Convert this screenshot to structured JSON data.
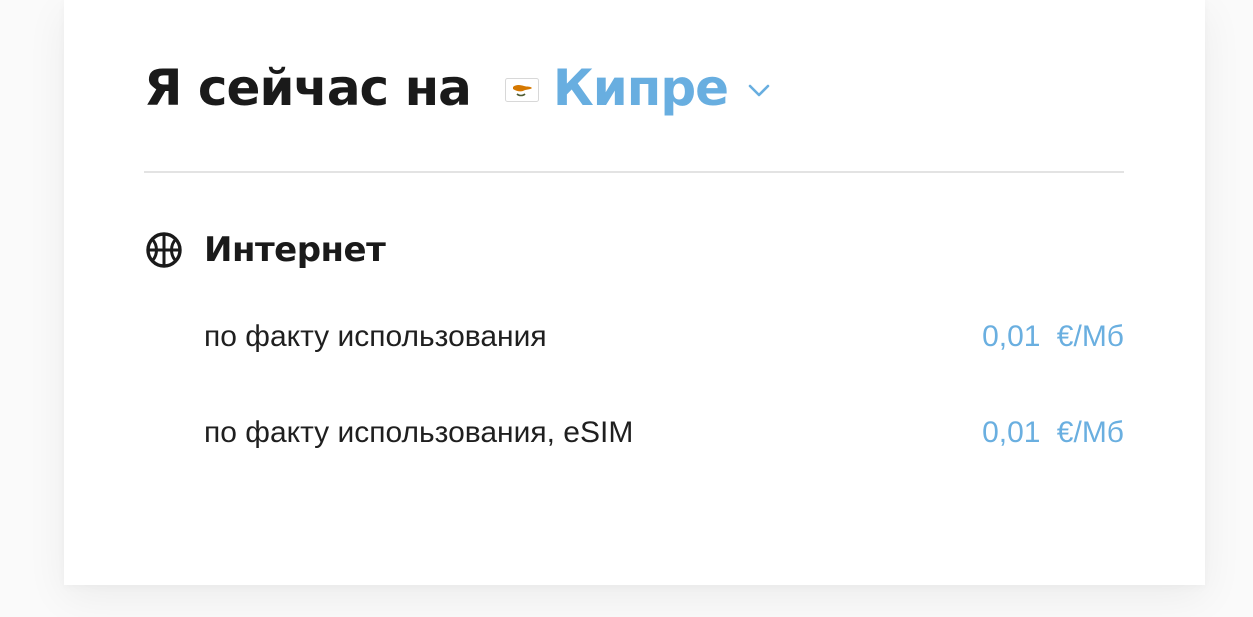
{
  "header": {
    "title": "Я сейчас на",
    "country": "Кипре",
    "flag_icon": "cyprus-flag-icon"
  },
  "colors": {
    "accent": "#68aee0",
    "text": "#1a1a1a",
    "divider": "#e3e3e3"
  },
  "internet": {
    "title": "Интернет",
    "icon": "globe-icon",
    "rows": [
      {
        "label": "по факту использования",
        "price": "0,01 €/Мб"
      },
      {
        "label": "по факту использования, eSIM",
        "price": "0,01 €/Мб"
      }
    ]
  }
}
